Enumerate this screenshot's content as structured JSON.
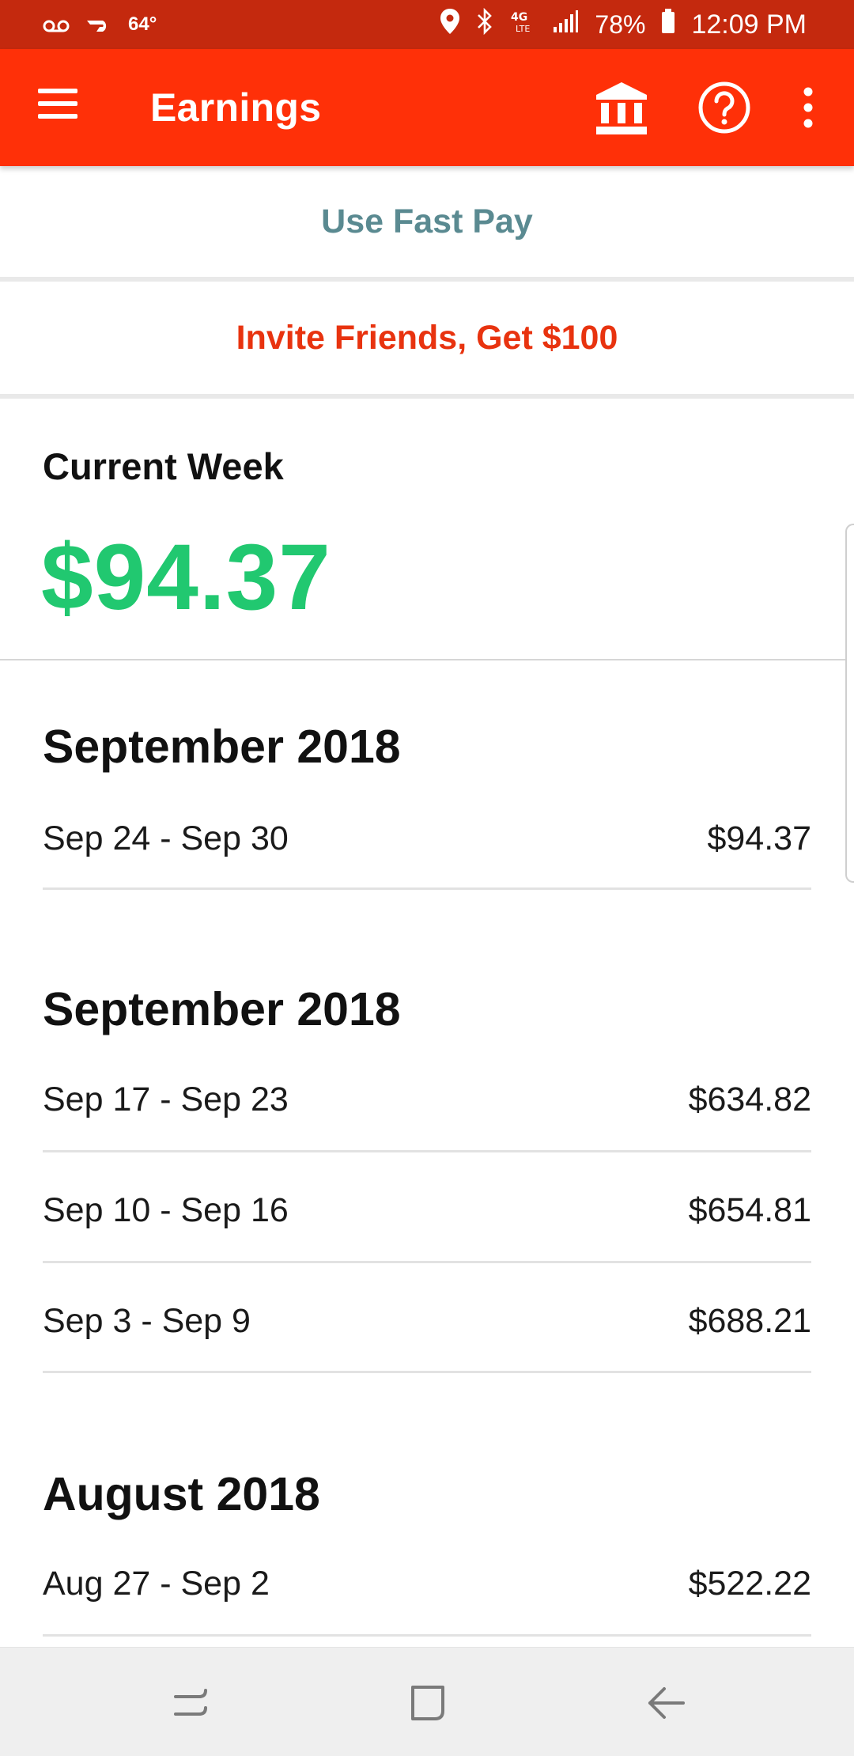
{
  "status_bar": {
    "temperature": "64°",
    "battery": "78%",
    "time": "12:09 PM",
    "icons": [
      "voicemail-icon",
      "doordash-icon",
      "location-icon",
      "bluetooth-icon",
      "lte-icon",
      "signal-icon",
      "battery-icon"
    ]
  },
  "app_bar": {
    "title": "Earnings",
    "icons": [
      "menu-icon",
      "bank-icon",
      "help-icon",
      "more-vert-icon"
    ]
  },
  "actions": {
    "fast_pay": "Use Fast Pay",
    "invite": "Invite Friends, Get $100"
  },
  "current_week": {
    "label": "Current Week",
    "amount": "$94.37"
  },
  "sections": [
    {
      "title": "September 2018",
      "rows": [
        {
          "range": "Sep 24 - Sep 30",
          "amount": "$94.37"
        }
      ]
    },
    {
      "title": "September 2018",
      "rows": [
        {
          "range": "Sep 17 - Sep 23",
          "amount": "$634.82"
        },
        {
          "range": "Sep 10 - Sep 16",
          "amount": "$654.81"
        },
        {
          "range": "Sep 3 - Sep 9",
          "amount": "$688.21"
        }
      ]
    },
    {
      "title": "August 2018",
      "rows": [
        {
          "range": "Aug 27 - Sep 2",
          "amount": "$522.22"
        }
      ]
    }
  ],
  "colors": {
    "status_bar": "#c4290e",
    "app_bar": "#ff3008",
    "fast_pay_text": "#5a8a91",
    "invite_text": "#e8330f",
    "earnings_green": "#21c870"
  },
  "nav_bar": {
    "icons": [
      "recent-apps-icon",
      "home-icon",
      "back-icon"
    ]
  }
}
